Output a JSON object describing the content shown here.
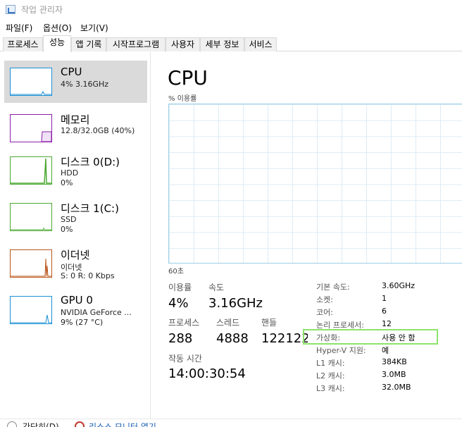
{
  "window": {
    "title": "작업 관리자"
  },
  "menu": {
    "file": "파일(F)",
    "options": "옵션(O)",
    "view": "보기(V)"
  },
  "tabs": [
    "프로세스",
    "성능",
    "앱 기록",
    "시작프로그램",
    "사용자",
    "세부 정보",
    "서비스"
  ],
  "sidebar": {
    "items": [
      {
        "name": "CPU",
        "sub1": "4% 3.16GHz",
        "sub2": "",
        "color": "#1a8fd6"
      },
      {
        "name": "메모리",
        "sub1": "12.8/32.0GB (40%)",
        "sub2": "",
        "color": "#8b1ea8"
      },
      {
        "name": "디스크 0(D:)",
        "sub1": "HDD",
        "sub2": "0%",
        "color": "#4ca833"
      },
      {
        "name": "디스크 1(C:)",
        "sub1": "SSD",
        "sub2": "0%",
        "color": "#4ca833"
      },
      {
        "name": "이더넷",
        "sub1": "이더넷",
        "sub2": "S: 0 R: 0 Kbps",
        "color": "#b8561a"
      },
      {
        "name": "GPU 0",
        "sub1": "NVIDIA GeForce ...",
        "sub2": "9% (27 °C)",
        "color": "#1a8fd6"
      }
    ]
  },
  "main": {
    "title": "CPU",
    "graph_label": "% 이용률",
    "graph_time": "60초",
    "stats": {
      "utilization_label": "이용률",
      "utilization": "4%",
      "speed_label": "속도",
      "speed": "3.16GHz",
      "processes_label": "프로세스",
      "processes": "288",
      "threads_label": "스레드",
      "threads": "4888",
      "handles_label": "핸들",
      "handles": "122122",
      "uptime_label": "작동 시간",
      "uptime": "14:00:30:54"
    },
    "specs": [
      {
        "label": "기본 속도:",
        "value": "3.60GHz"
      },
      {
        "label": "소켓:",
        "value": "1"
      },
      {
        "label": "코어:",
        "value": "6"
      },
      {
        "label": "논리 프로세서:",
        "value": "12"
      },
      {
        "label": "가상화:",
        "value": "사용 안 함"
      },
      {
        "label": "Hyper-V 지원:",
        "value": "예"
      },
      {
        "label": "L1 캐시:",
        "value": "384KB"
      },
      {
        "label": "L2 캐시:",
        "value": "3.0MB"
      },
      {
        "label": "L3 캐시:",
        "value": "32.0MB"
      }
    ]
  },
  "footer": {
    "fewer_details": "간단히(D)",
    "resource_monitor": "리소스 모니터 열기"
  }
}
